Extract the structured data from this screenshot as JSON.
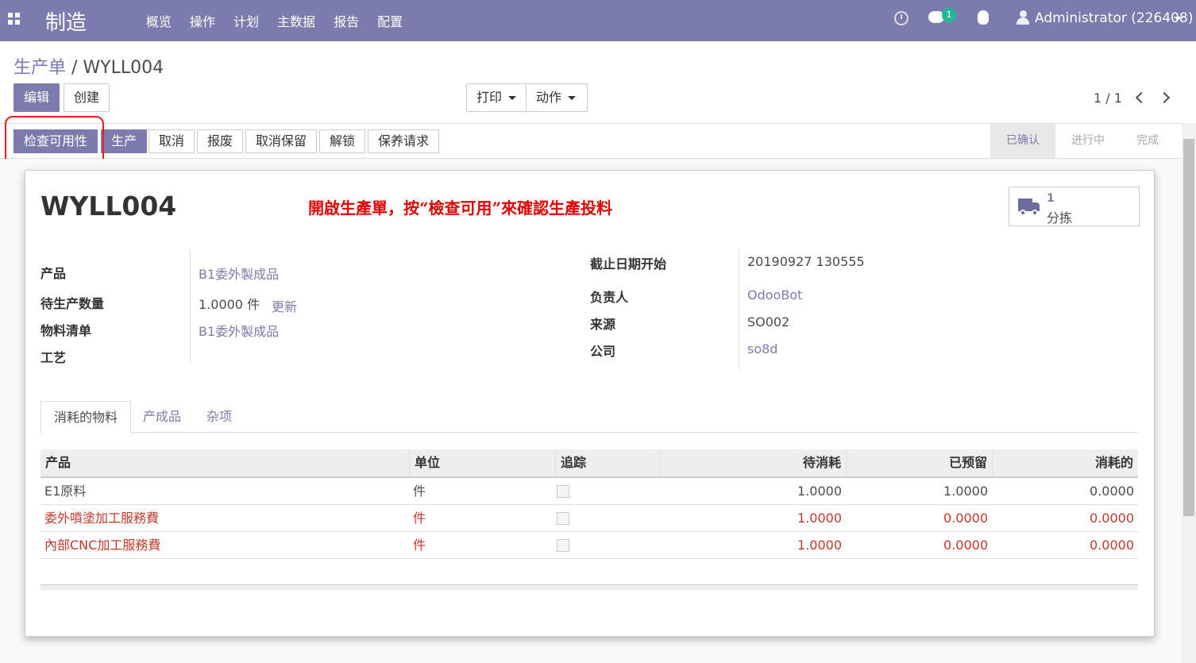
{
  "navbar": {
    "brand": "制造",
    "menu": [
      "概览",
      "操作",
      "计划",
      "主数据",
      "报告",
      "配置"
    ],
    "message_count": "1",
    "user": "Administrator (226408)"
  },
  "breadcrumb": {
    "parent": "生产单",
    "separator": " / ",
    "current": "WYLL004"
  },
  "buttons": {
    "edit": "编辑",
    "create": "创建",
    "print": "打印",
    "action": "动作"
  },
  "pager": "1 / 1",
  "status_buttons": [
    "检查可用性",
    "生产",
    "取消",
    "报废",
    "取消保留",
    "解锁",
    "保养请求"
  ],
  "stages": [
    "已确认",
    "进行中",
    "完成"
  ],
  "record": {
    "title": "WYLL004",
    "annotation": "開啟生產單，按“檢查可用”來確認生產投料",
    "smart_button": {
      "count": "1",
      "label": "分拣"
    },
    "left_fields": {
      "product_label": "产品",
      "product_value": "B1委外製成品",
      "qty_label": "待生产数量",
      "qty_value": "1.0000 件",
      "qty_update": "更新",
      "bom_label": "物料清单",
      "bom_value": "B1委外製成品",
      "routing_label": "工艺"
    },
    "right_fields": {
      "deadline_label": "截止日期开始",
      "deadline_value": "20190927 130555",
      "responsible_label": "负责人",
      "responsible_value": "OdooBot",
      "origin_label": "来源",
      "origin_value": "SO002",
      "company_label": "公司",
      "company_value": "so8d"
    }
  },
  "tabs": [
    "消耗的物料",
    "产成品",
    "杂项"
  ],
  "table": {
    "headers": [
      "产品",
      "单位",
      "追踪",
      "待消耗",
      "已预留",
      "消耗的"
    ],
    "rows": [
      {
        "product": "E1原料",
        "uom": "件",
        "to_consume": "1.0000",
        "reserved": "1.0000",
        "consumed": "0.0000"
      },
      {
        "product": "委外噴塗加工服務費",
        "uom": "件",
        "to_consume": "1.0000",
        "reserved": "0.0000",
        "consumed": "0.0000"
      },
      {
        "product": "內部CNC加工服務費",
        "uom": "件",
        "to_consume": "1.0000",
        "reserved": "0.0000",
        "consumed": "0.0000"
      }
    ]
  },
  "colors": {
    "brand": "#7c7bad",
    "highlight": "#e02020",
    "warning_row": "#c0392b"
  }
}
